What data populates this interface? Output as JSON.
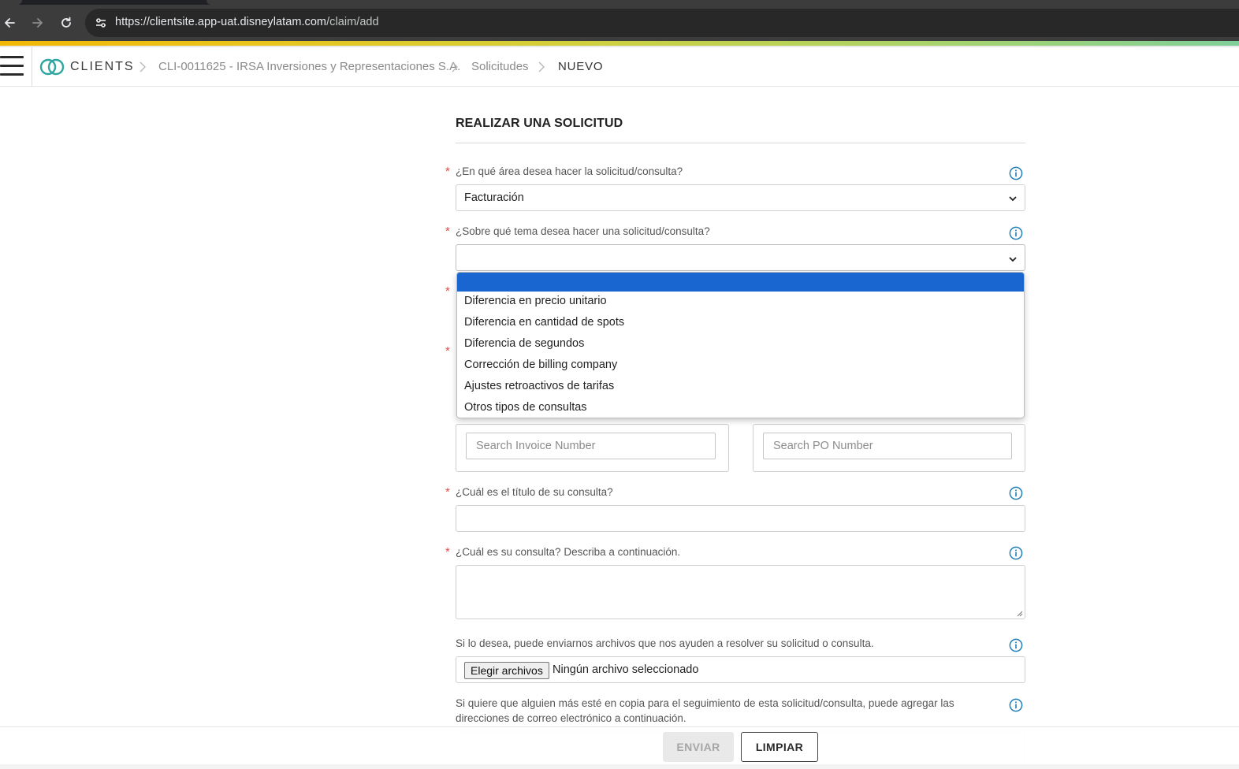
{
  "browser": {
    "url_host": "https://clientsite.app-uat.disneylatam.com",
    "url_path": "/claim/add"
  },
  "header": {
    "brand": "CLIENTS",
    "breadcrumbs": [
      "CLI-0011625 - IRSA Inversiones y Representaciones S.A.",
      "Solicitudes",
      "NUEVO"
    ]
  },
  "form": {
    "title": "REALIZAR UNA SOLICITUD",
    "required_mark": "*",
    "area": {
      "label": "¿En qué área desea hacer la solicitud/consulta?",
      "value": "Facturación"
    },
    "topic": {
      "label": "¿Sobre qué tema desea hacer una solicitud/consulta?",
      "value": "",
      "options": [
        "",
        "Diferencia en precio unitario",
        "Diferencia en cantidad de spots",
        "Diferencia de segundos",
        "Corrección de billing company",
        "Ajustes retroactivos de tarifas",
        "Otros tipos de consultas"
      ]
    },
    "search": {
      "invoice_placeholder": "Search Invoice Number",
      "po_placeholder": "Search PO Number"
    },
    "subject": {
      "label": "¿Cuál es el título de su consulta?",
      "value": ""
    },
    "description": {
      "label": "¿Cuál es su consulta? Describa a continuación.",
      "value": ""
    },
    "attachments": {
      "label": "Si lo desea, puede enviarnos archivos que nos ayuden a resolver su solicitud o consulta.",
      "button": "Elegir archivos",
      "status": "Ningún archivo seleccionado"
    },
    "cc": {
      "label": "Si quiere que alguien más esté en copia para el seguimiento de esta solicitud/consulta, puede agregar las direcciones de correo electrónico a continuación."
    }
  },
  "actions": {
    "send": "ENVIAR",
    "clear": "LIMPIAR"
  },
  "colors": {
    "accent_blue": "#1a66d1",
    "info_icon": "#1f7db8",
    "required": "#e04b4b",
    "brand_teal": "#2fa6a0"
  }
}
